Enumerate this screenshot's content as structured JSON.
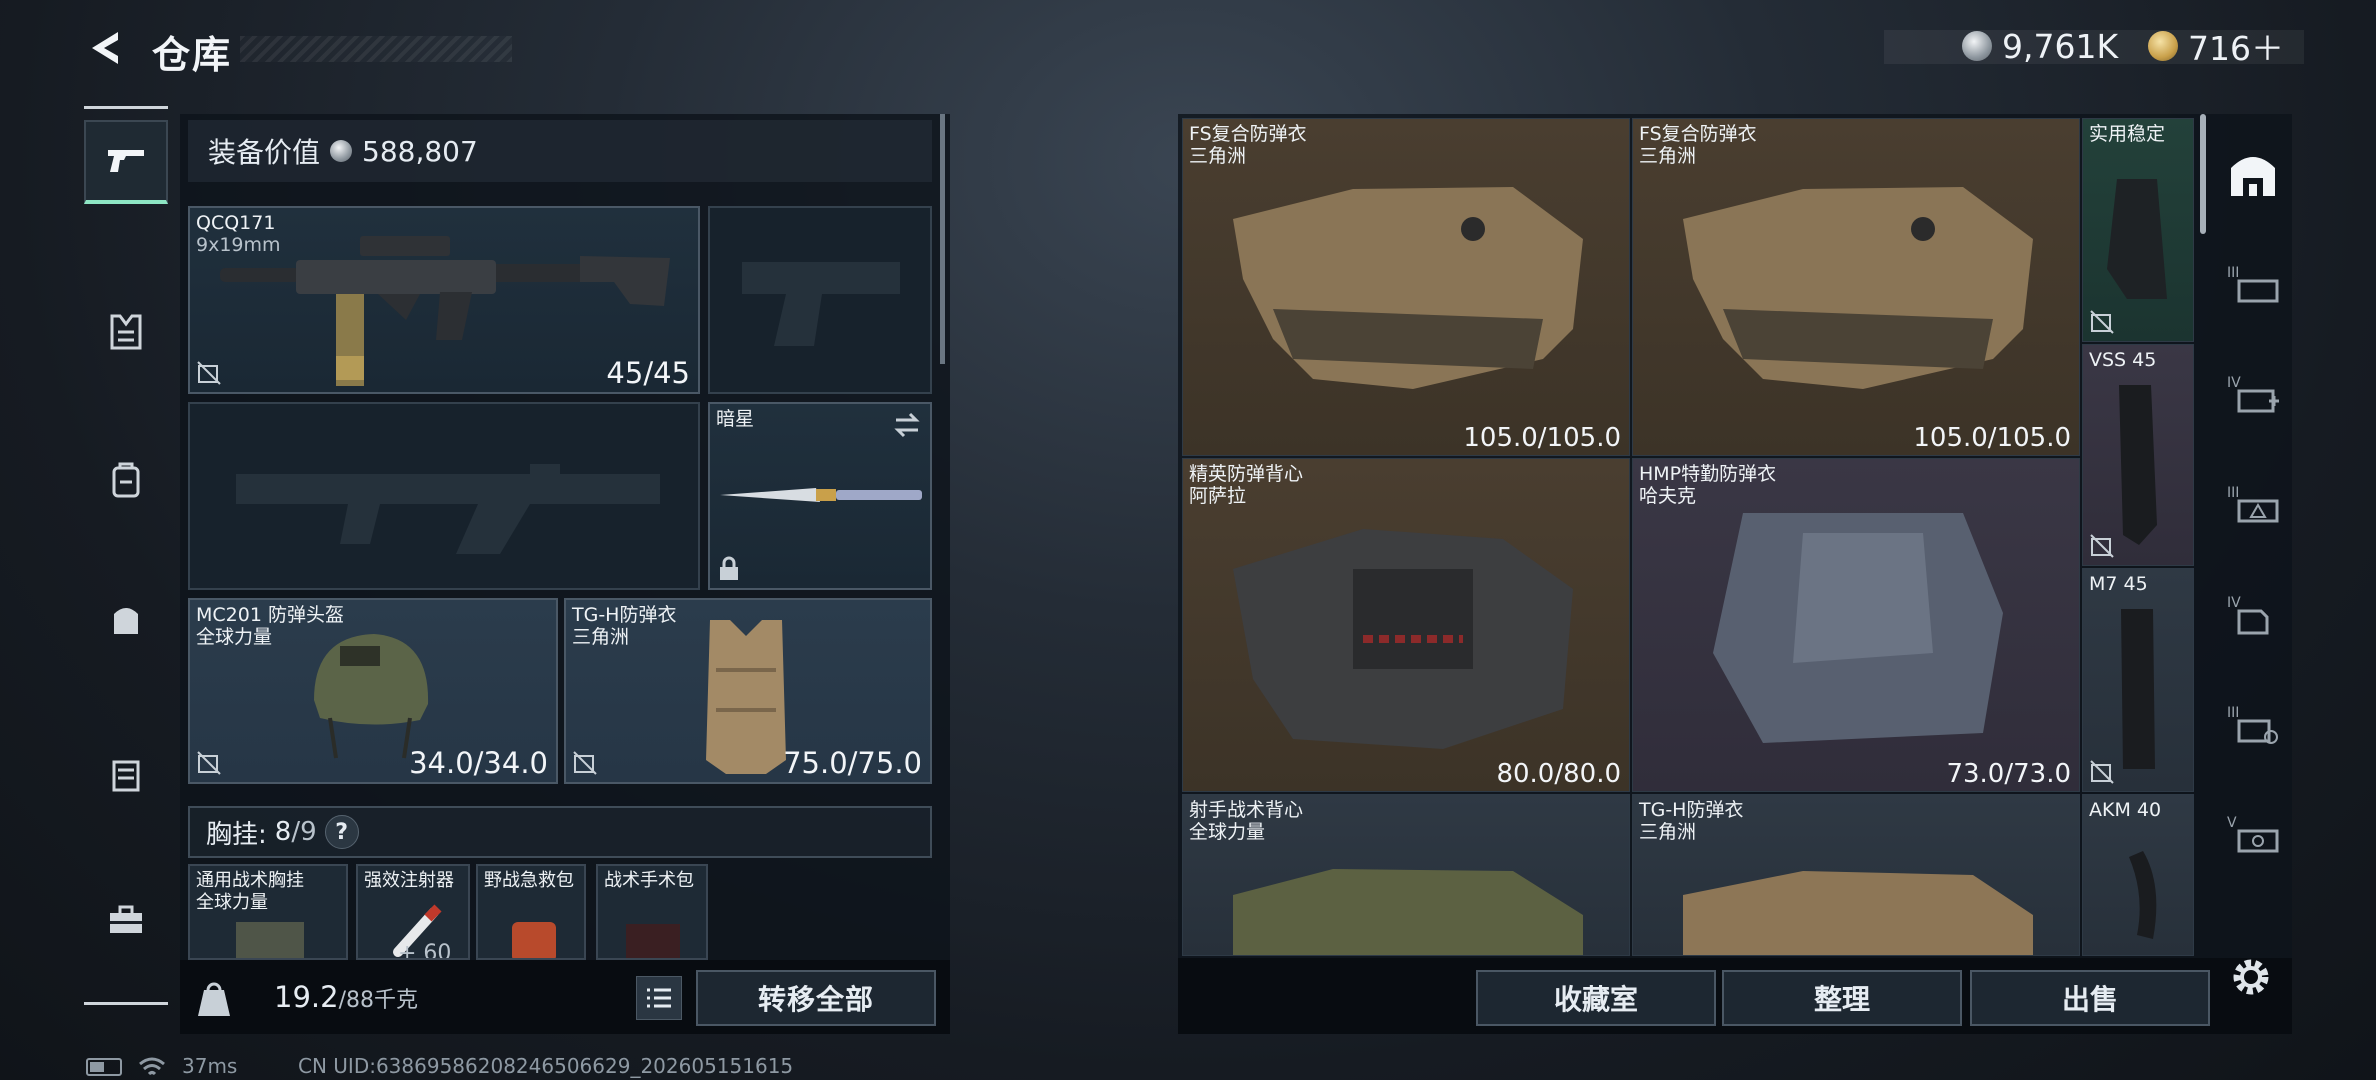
{
  "header": {
    "title": "仓库",
    "currency_silver": "9,761K",
    "currency_gold": "716＋"
  },
  "equipment": {
    "value_label": "装备价值",
    "value": "588,807",
    "primary_weapon": {
      "name": "QCQ171",
      "caliber": "9x19mm",
      "ammo": "45/45"
    },
    "melee": {
      "name": "暗星"
    },
    "helmet": {
      "name": "MC201 防弹头盔",
      "faction": "全球力量",
      "durability": "34.0/34.0"
    },
    "armor": {
      "name": "TG-H防弹衣",
      "faction": "三角洲",
      "durability": "75.0/75.0"
    },
    "chest_rig": {
      "label": "胸挂:",
      "used": "8",
      "total": "/9",
      "help": "?"
    },
    "pockets": [
      {
        "name": "通用战术胸挂",
        "sub": "全球力量"
      },
      {
        "name": "强效注射器",
        "sub": "",
        "count": "+ 60"
      },
      {
        "name": "野战急救包",
        "sub": ""
      },
      {
        "name": "战术手术包",
        "sub": ""
      }
    ]
  },
  "footer_left": {
    "weight_current": "19.2",
    "weight_max": "/88千克",
    "transfer_all": "转移全部"
  },
  "status_bar": {
    "ping": "37ms",
    "uid": "CN UID:6386958620824650662​9_202605151615"
  },
  "stash": {
    "items": [
      {
        "name": "FS复合防弹衣",
        "sub": "三角洲",
        "durability": "105.0/105.0"
      },
      {
        "name": "FS复合防弹衣",
        "sub": "三角洲",
        "durability": "105.0/105.0"
      },
      {
        "name": "实用稳定",
        "sub": ""
      },
      {
        "name": "VSS 45",
        "sub": ""
      },
      {
        "name": "精英防弹背心",
        "sub": "阿萨拉",
        "durability": "80.0/80.0"
      },
      {
        "name": "HMP特勤防弹衣",
        "sub": "哈夫克",
        "durability": "73.0/73.0"
      },
      {
        "name": "M7 45",
        "sub": ""
      },
      {
        "name": "射手战术背心",
        "sub": "全球力量"
      },
      {
        "name": "TG-H防弹衣",
        "sub": "三角洲"
      },
      {
        "name": "AKM 40",
        "sub": ""
      }
    ],
    "actions": {
      "vault": "收藏室",
      "sort": "整理",
      "sell": "出售"
    }
  },
  "right_nav": [
    "home",
    "III",
    "IV",
    "III",
    "IV",
    "III",
    "V"
  ],
  "colors": {
    "accent": "#8ee6c4",
    "tan_cell": "#4a3e30",
    "purple_cell": "#3a3745",
    "green_cell": "#23413a"
  }
}
